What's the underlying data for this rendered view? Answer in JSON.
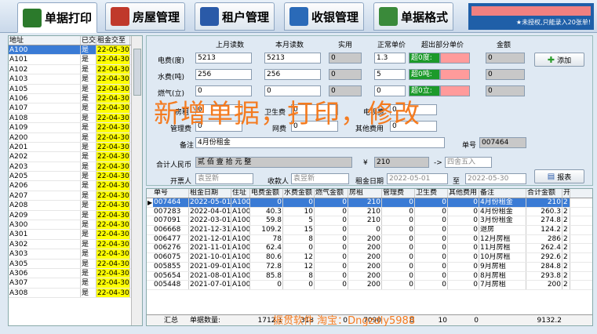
{
  "tabs": [
    {
      "label": "单据打印",
      "icon": "printer-icon",
      "color": "#2b7a2b"
    },
    {
      "label": "房屋管理",
      "icon": "house-icon",
      "color": "#c0392b"
    },
    {
      "label": "租户管理",
      "icon": "person-icon",
      "color": "#2a5aa8"
    },
    {
      "label": "收银管理",
      "icon": "search-icon",
      "color": "#2a6ab8"
    },
    {
      "label": "单据格式",
      "icon": "edit-icon",
      "color": "#3a8a3a"
    }
  ],
  "trial": {
    "line1": "★未授权,只能录入20张单!"
  },
  "left": {
    "headers": [
      "地址",
      "已交",
      "租金交至"
    ],
    "rows": [
      [
        "A100",
        "是",
        "22-05-30"
      ],
      [
        "A101",
        "是",
        "22-04-30"
      ],
      [
        "A102",
        "是",
        "22-04-30"
      ],
      [
        "A103",
        "是",
        "22-04-30"
      ],
      [
        "A105",
        "是",
        "22-04-30"
      ],
      [
        "A106",
        "是",
        "22-04-30"
      ],
      [
        "A107",
        "是",
        "22-04-30"
      ],
      [
        "A108",
        "是",
        "22-04-30"
      ],
      [
        "A109",
        "是",
        "22-04-30"
      ],
      [
        "A200",
        "是",
        "22-04-30"
      ],
      [
        "A201",
        "是",
        "22-04-30"
      ],
      [
        "A202",
        "是",
        "22-04-30"
      ],
      [
        "A203",
        "是",
        "22-04-30"
      ],
      [
        "A205",
        "是",
        "22-04-30"
      ],
      [
        "A206",
        "是",
        "22-04-30"
      ],
      [
        "A207",
        "是",
        "22-04-30"
      ],
      [
        "A208",
        "是",
        "22-04-30"
      ],
      [
        "A209",
        "是",
        "22-04-30"
      ],
      [
        "A300",
        "是",
        "22-04-30"
      ],
      [
        "A301",
        "是",
        "22-04-30"
      ],
      [
        "A302",
        "是",
        "22-04-30"
      ],
      [
        "A303",
        "是",
        "22-04-30"
      ],
      [
        "A305",
        "是",
        "22-04-30"
      ],
      [
        "A306",
        "是",
        "22-04-30"
      ],
      [
        "A307",
        "是",
        "22-04-30"
      ],
      [
        "A308",
        "是",
        "22-04-30"
      ]
    ]
  },
  "form": {
    "col_headers": [
      "上月读数",
      "本月读数",
      "实用",
      "正常单价",
      "超出部分单价",
      "金额"
    ],
    "elec_label": "电费(度)",
    "elec_prev": "5213",
    "elec_cur": "5213",
    "elec_used": "0",
    "elec_price": "1.3",
    "elec_over": "超0度:",
    "elec_amt": "0",
    "water_label": "水费(吨)",
    "water_prev": "256",
    "water_cur": "256",
    "water_used": "0",
    "water_price": "5",
    "water_over": "超0吨:",
    "water_amt": "0",
    "gas_label": "燃气(立)",
    "gas_prev": "0",
    "gas_cur": "0",
    "gas_used": "0",
    "gas_price": "0",
    "gas_over": "超0立:",
    "gas_amt": "0",
    "rent_label": "房租",
    "rent_val": "0",
    "sanit_label": "卫生费",
    "sanit_val": "0",
    "tv_label": "电视费",
    "tv_val": "0",
    "mgmt_label": "管理费",
    "mgmt_val": "0",
    "net_label": "网费",
    "net_val": "0",
    "other_label": "其他费用",
    "other_val": "0",
    "note_label": "备注",
    "note_val": "4月份租金",
    "bill_no_label": "单号",
    "bill_no": "007464",
    "total_cn_label": "合计人民币",
    "total_cn": "贰 佰 壹 拾 元 整",
    "yen": "¥",
    "total": "210",
    "round_arrow": "->",
    "round_mode": "四舍五入",
    "issuer_label": "开票人",
    "issuer": "袁昱新",
    "payee_label": "收款人",
    "payee": "袁昱新",
    "rent_date_label": "租金日期",
    "rent_from": "2022-05-01",
    "to_label": "至",
    "rent_to": "2022-05-30",
    "add_btn": "添加",
    "report_btn": "报表"
  },
  "overlay": "新增单据，打印，修改",
  "grid": {
    "headers": [
      "单号",
      "租金日期",
      "住址",
      "电费金额",
      "水费金额",
      "燃气金额",
      "房租",
      "管理费",
      "卫生费",
      "其他费用",
      "备注",
      "合计金额",
      "开"
    ],
    "rows": [
      [
        "007464",
        "2022-05-01",
        "A100",
        "0",
        "0",
        "0",
        "210",
        "0",
        "0",
        "0",
        "4月份租金",
        "210",
        "2"
      ],
      [
        "007283",
        "2022-04-01",
        "A100",
        "40.3",
        "10",
        "0",
        "210",
        "0",
        "0",
        "0",
        "4月份租金",
        "260.3",
        "2"
      ],
      [
        "007091",
        "2022-03-01",
        "A100",
        "59.8",
        "5",
        "0",
        "210",
        "0",
        "0",
        "0",
        "3月份租金",
        "274.8",
        "2"
      ],
      [
        "006668",
        "2021-12-31",
        "A100",
        "109.2",
        "15",
        "0",
        "0",
        "0",
        "0",
        "0",
        "退房",
        "124.2",
        "2"
      ],
      [
        "006477",
        "2021-12-01",
        "A100",
        "78",
        "8",
        "0",
        "200",
        "0",
        "0",
        "0",
        "12月房租",
        "286",
        "2"
      ],
      [
        "006276",
        "2021-11-01",
        "A100",
        "62.4",
        "0",
        "0",
        "200",
        "0",
        "0",
        "0",
        "11月房租",
        "262.4",
        "2"
      ],
      [
        "006075",
        "2021-10-01",
        "A100",
        "80.6",
        "12",
        "0",
        "200",
        "0",
        "0",
        "0",
        "10月房租",
        "292.6",
        "2"
      ],
      [
        "005855",
        "2021-09-01",
        "A100",
        "72.8",
        "12",
        "0",
        "200",
        "0",
        "0",
        "0",
        "9月房租",
        "284.8",
        "2"
      ],
      [
        "005654",
        "2021-08-01",
        "A100",
        "85.8",
        "8",
        "0",
        "200",
        "0",
        "0",
        "0",
        "8月房租",
        "293.8",
        "2"
      ],
      [
        "005448",
        "2021-07-01",
        "A100",
        "0",
        "0",
        "0",
        "200",
        "0",
        "0",
        "0",
        "7月房租",
        "200",
        "2"
      ]
    ],
    "sum": {
      "label": "汇总",
      "count_label": "单据数量:",
      "elec": "1712.1",
      "water": "318",
      "gas": "0",
      "rent": "7090",
      "mgmt": "0",
      "sanit": "10",
      "other": "0",
      "total": "9132.2"
    }
  },
  "footer": "振贯软件  淘宝：Dngzdly5988"
}
